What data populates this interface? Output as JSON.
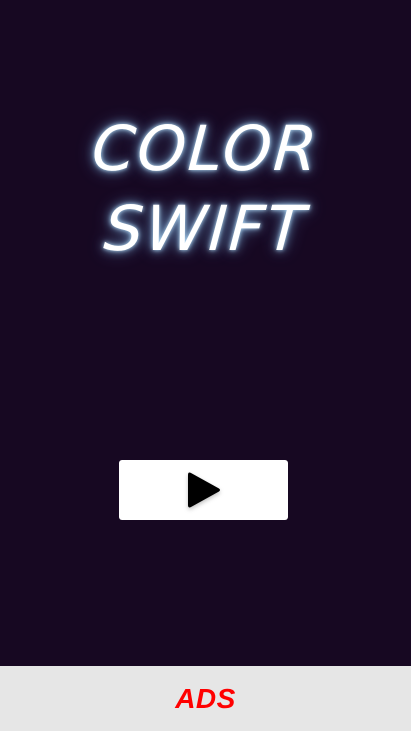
{
  "game": {
    "title_line_1": "COLOR",
    "title_line_2": "SWIFT",
    "play_icon": "play-icon"
  },
  "ads": {
    "label": "ADS"
  },
  "colors": {
    "background": "#170822",
    "title": "#ffffff",
    "title_glow": "#9fd3ff",
    "play_button": "#ffffff",
    "play_icon": "#000000",
    "ads_bar": "#e6e6e6",
    "ads_text": "#ff0000"
  }
}
